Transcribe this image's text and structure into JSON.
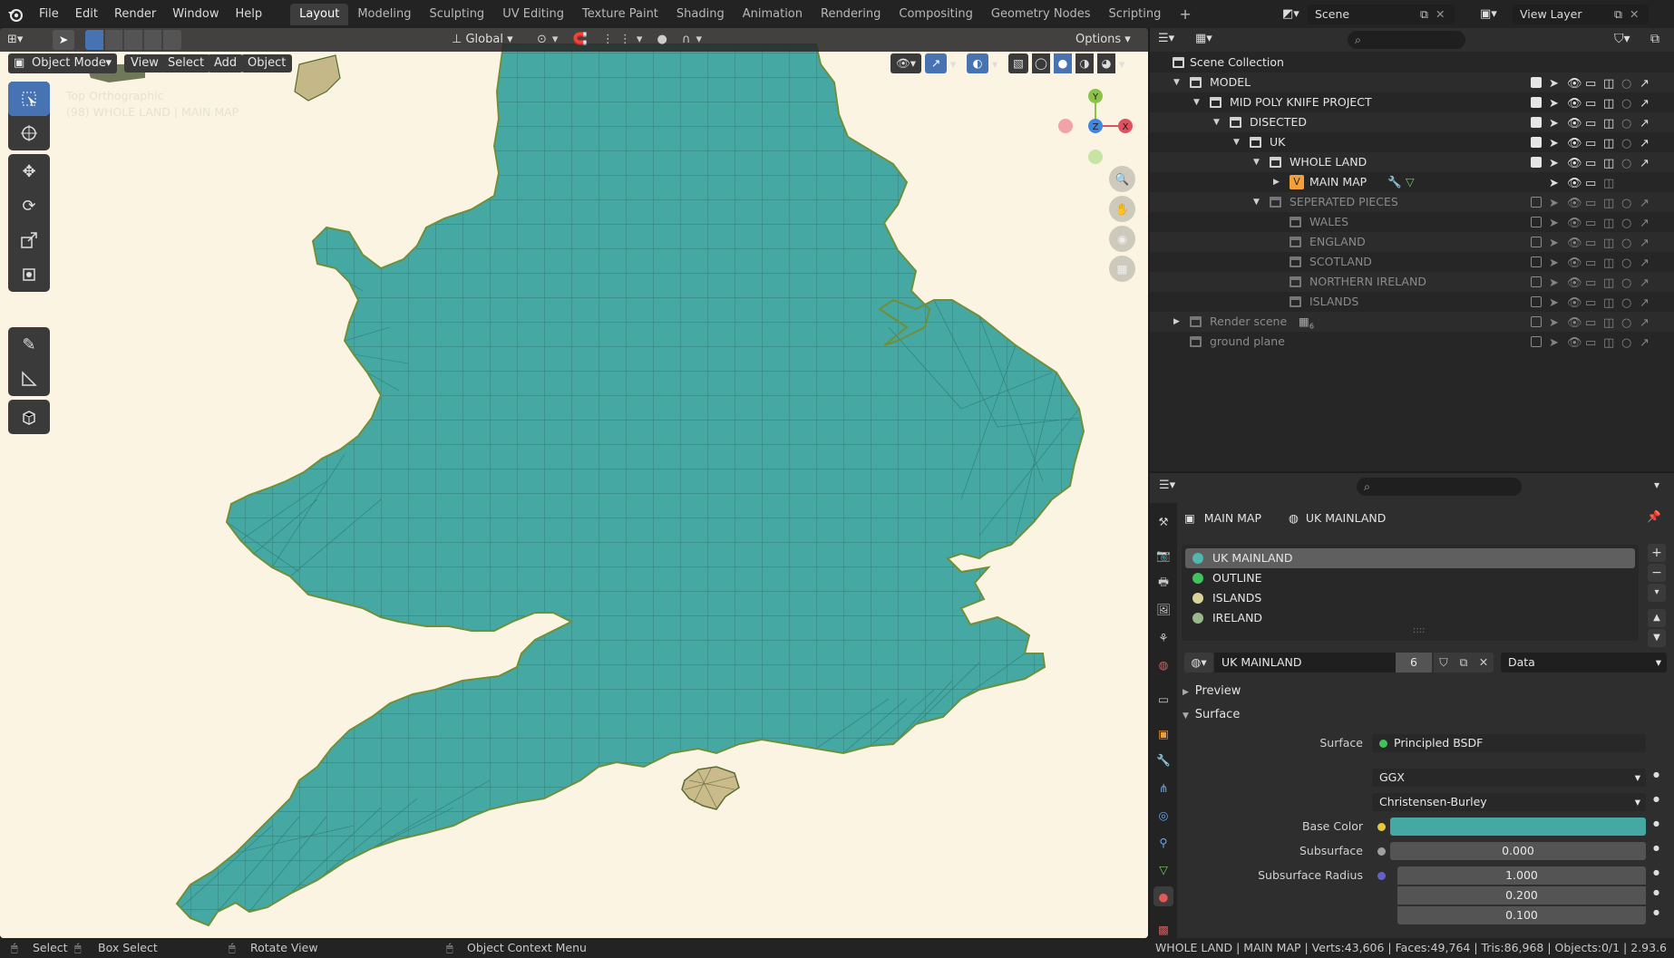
{
  "menu": {
    "items": [
      "File",
      "Edit",
      "Render",
      "Window",
      "Help"
    ]
  },
  "workspaces": {
    "tabs": [
      "Layout",
      "Modeling",
      "Sculpting",
      "UV Editing",
      "Texture Paint",
      "Shading",
      "Animation",
      "Rendering",
      "Compositing",
      "Geometry Nodes",
      "Scripting"
    ],
    "active": "Layout",
    "add": "+"
  },
  "scene": {
    "name": "Scene",
    "view_layer": "View Layer"
  },
  "viewport": {
    "mode": "Object Mode",
    "menus": [
      "View",
      "Select",
      "Add",
      "Object"
    ],
    "orientation": "Global",
    "options": "Options",
    "overlay_title": "Top Orthographic",
    "overlay_sub": "(98) WHOLE LAND | MAIN MAP",
    "gizmo": {
      "y": "Y",
      "z": "Z",
      "x": "X"
    }
  },
  "outliner": {
    "root": "Scene Collection",
    "rows": [
      {
        "label": "MODEL",
        "dim": false
      },
      {
        "label": "MID POLY KNIFE PROJECT",
        "dim": false
      },
      {
        "label": "DISECTED",
        "dim": false
      },
      {
        "label": "UK",
        "dim": false
      },
      {
        "label": "WHOLE LAND",
        "dim": false
      },
      {
        "label": "MAIN MAP",
        "dim": false
      },
      {
        "label": "SEPERATED PIECES",
        "dim": true
      },
      {
        "label": "WALES",
        "dim": true
      },
      {
        "label": "ENGLAND",
        "dim": true
      },
      {
        "label": "SCOTLAND",
        "dim": true
      },
      {
        "label": "NORTHERN IRELAND",
        "dim": true
      },
      {
        "label": "ISLANDS",
        "dim": true
      },
      {
        "label": "Render scene",
        "dim": true
      },
      {
        "label": "ground plane",
        "dim": true
      }
    ],
    "sub_count": "6"
  },
  "properties": {
    "breadcrumb_object": "MAIN MAP",
    "breadcrumb_material": "UK MAINLAND",
    "slots": [
      {
        "label": "UK MAINLAND",
        "color": "#4fb8b0"
      },
      {
        "label": "OUTLINE",
        "color": "#3fc35a"
      },
      {
        "label": "ISLANDS",
        "color": "#d9d49a"
      },
      {
        "label": "IRELAND",
        "color": "#9ab88a"
      }
    ],
    "material_name": "UK MAINLAND",
    "users": "6",
    "link": "Data",
    "panel_preview": "Preview",
    "panel_surface": "Surface",
    "surface_label": "Surface",
    "surface_value": "Principled BSDF",
    "distribution": "GGX",
    "subsurface_method": "Christensen-Burley",
    "base_color_label": "Base Color",
    "base_color": "#45a8a2",
    "subsurface_label": "Subsurface",
    "subsurface_value": "0.000",
    "subsurface_radius_label": "Subsurface Radius",
    "radius": [
      "1.000",
      "0.200",
      "0.100"
    ]
  },
  "status": {
    "select": "Select",
    "box_select": "Box Select",
    "rotate": "Rotate View",
    "context": "Object Context Menu",
    "stats": "WHOLE LAND | MAIN MAP | Verts:43,606 | Faces:49,764 | Tris:86,968 | Objects:0/1 | 2.93.6"
  },
  "colors": {
    "accent": "#4773b2",
    "land": "#45a8a2",
    "background": "#fcf4e2"
  }
}
